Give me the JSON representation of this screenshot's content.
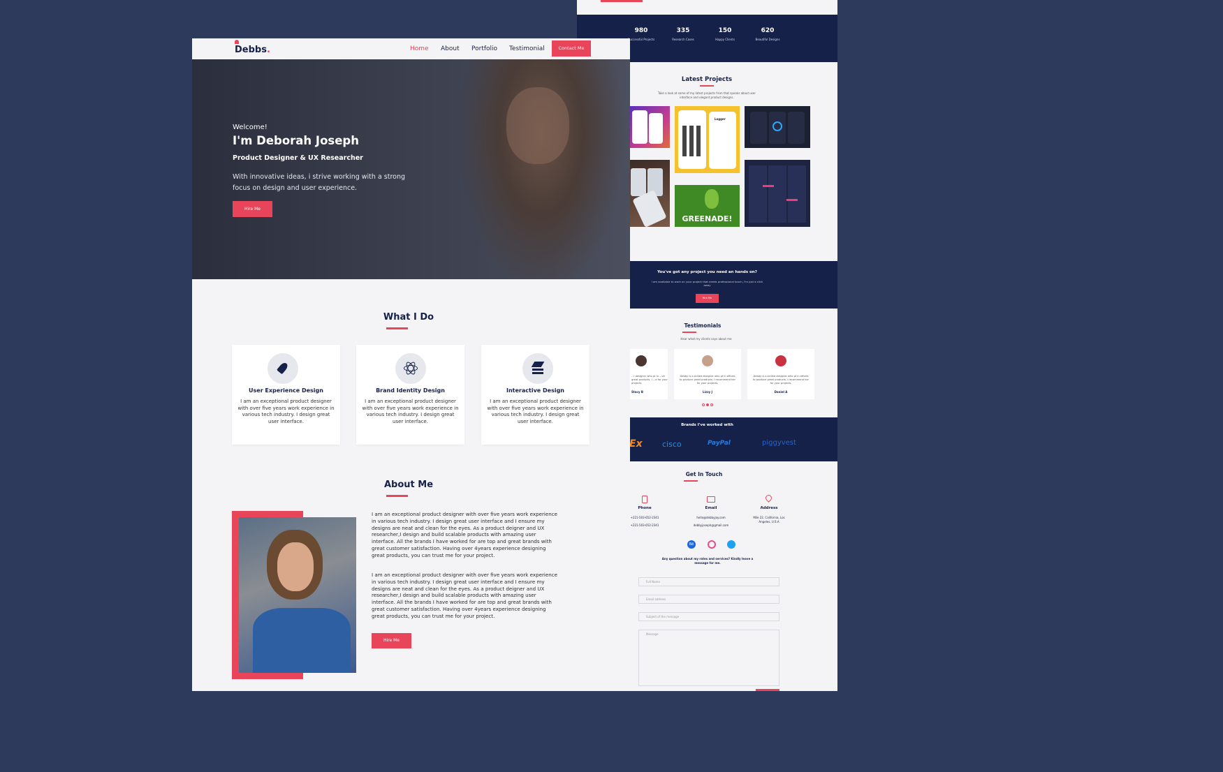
{
  "colors": {
    "background": "#2e3a5c",
    "accent": "#e8445a",
    "navy": "#152149",
    "surface": "#f4f4f6"
  },
  "right_panel": {
    "stats": [
      {
        "number": "980",
        "label": "Successful Projects"
      },
      {
        "number": "335",
        "label": "Research Cases"
      },
      {
        "number": "150",
        "label": "Happy Clients"
      },
      {
        "number": "620",
        "label": "Beautiful Designs"
      }
    ],
    "projects": {
      "title": "Latest Projects",
      "subtitle": "Take a look at some of my latest projects from that speaks about user interface and elegant product designs.",
      "greenade_label": "GREENADE!",
      "logger_label": "Logger"
    },
    "cta": {
      "title": "You've got any project you need an hands on?",
      "text": "I am available to work on your project that needs professional touch, I'm just a click away",
      "button": "Hire Me"
    },
    "testimonials": {
      "title": "Testimonials",
      "subtitle": "Hear what my clients says about me",
      "items": [
        {
          "name": "Stacy B",
          "text": "...l designer who pt in ...ve great products. I ...d for your projects."
        },
        {
          "name": "Lizzy J",
          "text": "Debby is a skilled designer who pt in efforts to produce great products. I recommend her for your projects."
        },
        {
          "name": "Daniel A",
          "text": "Debby is a skilled designer who pt in efforts to produce great products. I recommend her for your projects."
        }
      ]
    },
    "brands": {
      "title": "Brands I've worked with",
      "items": [
        "Ex",
        "cisco",
        "PayPal",
        "piggyvest"
      ]
    },
    "contact": {
      "title": "Get In Touch",
      "phone": {
        "label": "Phone",
        "lines": [
          "+221-503-652-2341",
          "+221-503-652-2341"
        ]
      },
      "email": {
        "label": "Email",
        "lines": [
          "hello@debbyjay.com",
          "debbyjoseph@gmail.com"
        ]
      },
      "address": {
        "label": "Address",
        "lines": [
          "Mile 22, California, Los",
          "Angeles, U.S.A"
        ]
      },
      "question": "Any question about my rates and services? Kindly leave a message for me.",
      "placeholders": {
        "name": "Full Name",
        "email": "Email address",
        "subject": "Subject of the message",
        "message": "Message"
      },
      "social_behance": "Bē"
    }
  },
  "left_panel": {
    "logo": "Debbs",
    "logo_dot": ".",
    "nav": {
      "home": "Home",
      "about": "About",
      "portfolio": "Portfolio",
      "testimonial": "Testimonial",
      "contact": "Contact Me"
    },
    "hero": {
      "welcome": "Welcome!",
      "name": "I'm Deborah Joseph",
      "role": "Product Designer & UX Researcher",
      "intro": "With innovative ideas, i strive working with a strong focus on design and user experience.",
      "button": "Hire Me"
    },
    "what_i_do": {
      "title": "What I Do",
      "cards": [
        {
          "title": "User Experience Design",
          "text": "I am an exceptional product designer with over five years work experience in various tech industry. I design great user interface."
        },
        {
          "title": "Brand Identity Design",
          "text": "I am an exceptional product designer with over five years work experience in various tech industry. I design great user interface."
        },
        {
          "title": "Interactive Design",
          "text": "I am an exceptional product designer with over five years work experience in various tech industry. I design great user interface."
        }
      ]
    },
    "about": {
      "title": "About Me",
      "p1": "I am an exceptional product designer with over five years work experience in various tech industry. I design great user interface and I ensure my designs are neat and clean for the eyes. As a product deigner and UX researcher,I design and build scalable products with amazing user interface.  All the brands I have worked for are top and great brands with great customer satisfaction. Having over 4years experience designing great products, you can trust me for your project.",
      "p2": "I am an exceptional product designer with over five years work experience in various tech industry. I design great user interface and I ensure my designs are neat and clean for the eyes. As a product deigner and UX researcher,I design and build scalable products with amazing user interface.  All the brands I have worked for are top and great brands with great customer satisfaction. Having over 4years experience designing great products, you can trust me for your project.",
      "button": "Hire Me"
    }
  }
}
